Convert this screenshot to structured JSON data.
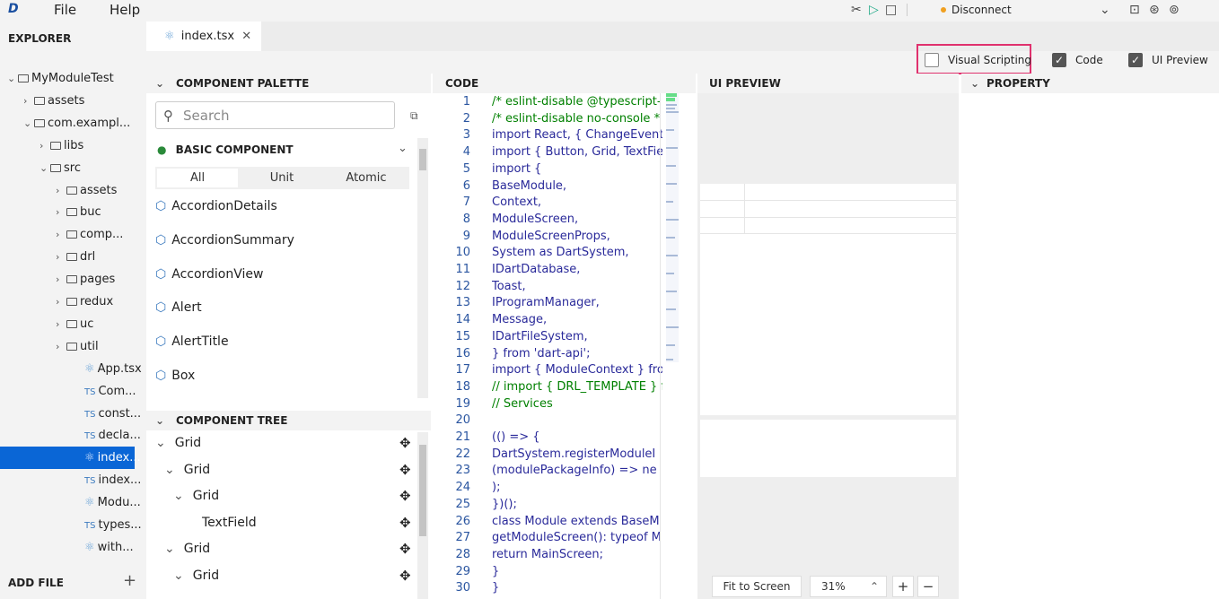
{
  "menu": {
    "logo": "D",
    "file": "File",
    "help": "Help"
  },
  "toolbar": {
    "disconnect": "Disconnect"
  },
  "explorer": {
    "title": "EXPLORER",
    "items": [
      {
        "label": "MyModuleTest",
        "type": "folder-open"
      },
      {
        "label": "assets",
        "type": "folder"
      },
      {
        "label": "com.exampl...",
        "type": "folder-open"
      },
      {
        "label": "libs",
        "type": "folder"
      },
      {
        "label": "src",
        "type": "folder-open"
      },
      {
        "label": "assets",
        "type": "folder"
      },
      {
        "label": "buc",
        "type": "folder"
      },
      {
        "label": "comp...",
        "type": "folder"
      },
      {
        "label": "drl",
        "type": "folder"
      },
      {
        "label": "pages",
        "type": "folder"
      },
      {
        "label": "redux",
        "type": "folder"
      },
      {
        "label": "uc",
        "type": "folder"
      },
      {
        "label": "util",
        "type": "folder"
      },
      {
        "label": "App.tsx",
        "type": "react"
      },
      {
        "label": "Com...",
        "type": "ts"
      },
      {
        "label": "const...",
        "type": "ts"
      },
      {
        "label": "decla...",
        "type": "ts"
      },
      {
        "label": "index...",
        "type": "react-selected"
      },
      {
        "label": "index...",
        "type": "ts"
      },
      {
        "label": "Modu...",
        "type": "react"
      },
      {
        "label": "types...",
        "type": "ts"
      },
      {
        "label": "with...",
        "type": "react"
      }
    ],
    "add_file": "ADD FILE"
  },
  "tab": {
    "label": "index.tsx"
  },
  "view_toggles": {
    "visual_scripting": "Visual Scripting",
    "code": "Code",
    "ui_preview": "UI Preview"
  },
  "palette": {
    "title": "COMPONENT PALETTE",
    "search_placeholder": "Search",
    "group": "BASIC COMPONENT",
    "segments": [
      "All",
      "Unit",
      "Atomic"
    ],
    "components": [
      "AccordionDetails",
      "AccordionSummary",
      "AccordionView",
      "Alert",
      "AlertTitle",
      "Box"
    ]
  },
  "tree": {
    "title": "COMPONENT TREE",
    "items": [
      "Grid",
      "Grid",
      "Grid",
      "TextField",
      "Grid",
      "Grid"
    ]
  },
  "code": {
    "title": "CODE",
    "lines": [
      "/* eslint-disable @typescript-",
      "/* eslint-disable no-console *",
      "import React, { ChangeEvent",
      "import { Button, Grid, TextFie",
      "import {",
      "  BaseModule,",
      "  Context,",
      "  ModuleScreen,",
      "  ModuleScreenProps,",
      "  System as DartSystem,",
      "  IDartDatabase,",
      "  Toast,",
      "  IProgramManager,",
      "  Message,",
      "  IDartFileSystem,",
      "} from 'dart-api';",
      "import { ModuleContext } fro",
      "// import { DRL_TEMPLATE } fi",
      "// Services",
      "",
      "(() => {",
      "  DartSystem.registerModuleI",
      "    (modulePackageInfo) => ne",
      "  );",
      "})();",
      "class Module extends BaseM",
      "  getModuleScreen(): typeof M",
      "    return MainScreen;",
      "  }",
      "}"
    ]
  },
  "ui_preview": {
    "title": "UI PREVIEW",
    "fit_label": "Fit to Screen",
    "zoom": "31%"
  },
  "property": {
    "title": "PROPERTY"
  }
}
